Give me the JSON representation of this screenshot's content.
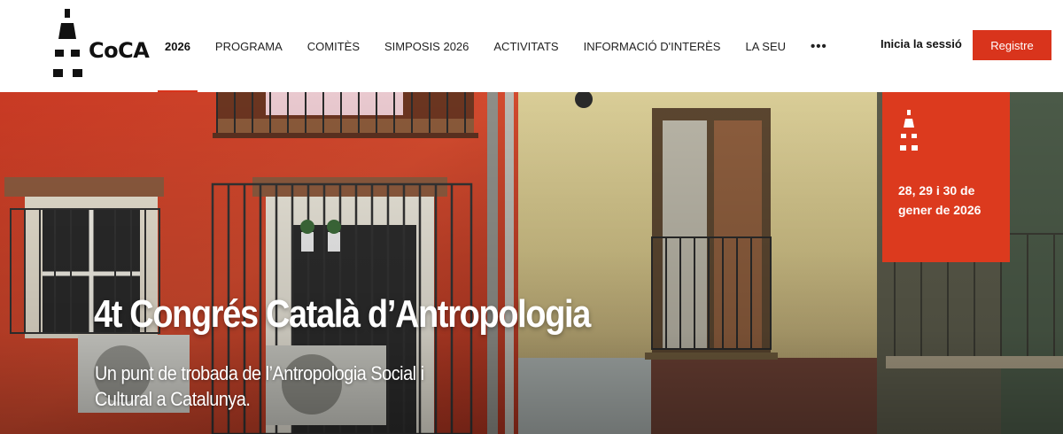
{
  "brand": {
    "name": "CoCA"
  },
  "nav": {
    "items": [
      {
        "label": "2026",
        "active": true
      },
      {
        "label": "PROGRAMA"
      },
      {
        "label": "COMITÈS"
      },
      {
        "label": "SIMPOSIS 2026"
      },
      {
        "label": "ACTIVITATS"
      },
      {
        "label": "INFORMACIÓ D'INTERÈS"
      },
      {
        "label": "LA SEU"
      }
    ],
    "more": "•••"
  },
  "account": {
    "login_label": "Inicia la sessió",
    "register_label": "Registre"
  },
  "hero": {
    "title": "4t Congrés Català d’Antropologia",
    "subtitle_line1": "Un punt de trobada de l’Antropologia Social i",
    "subtitle_line2": "Cultural a Catalunya.",
    "date_line1": "28, 29 i 30 de",
    "date_line2": "gener de 2026"
  },
  "colors": {
    "accent": "#d9341c",
    "date_box": "#dc3a1e"
  },
  "icons": {
    "logo": "coca-a-logo-icon",
    "more": "more-dots-icon",
    "date_box_logo": "coca-a-mark-icon"
  }
}
